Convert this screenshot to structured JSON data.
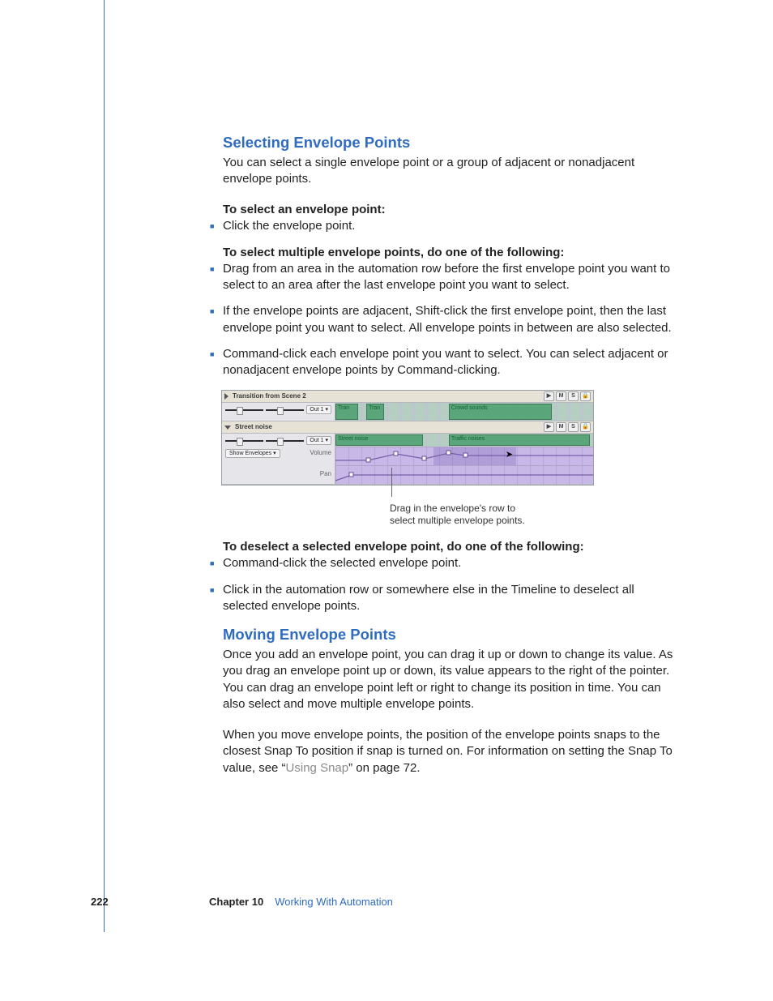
{
  "section1": {
    "title": "Selecting Envelope Points",
    "intro": "You can select a single envelope point or a group of adjacent or nonadjacent envelope points.",
    "lead1": "To select an envelope point:",
    "b1": "Click the envelope point.",
    "lead2": "To select multiple envelope points, do one of the following:",
    "b2a": "Drag from an area in the automation row before the first envelope point you want to select to an area after the last envelope point you want to select.",
    "b2b": "If the envelope points are adjacent, Shift-click the first envelope point, then the last envelope point you want to select. All envelope points in between are also selected.",
    "b2c": "Command-click each envelope point you want to select. You can select adjacent or nonadjacent envelope points by Command-clicking.",
    "lead3": "To deselect a selected envelope point, do one of the following:",
    "b3a": "Command-click the selected envelope point.",
    "b3b": "Click in the automation row or somewhere else in the Timeline to deselect all selected envelope points."
  },
  "figure": {
    "track1_name": "Transition from Scene 2",
    "track2_name": "Street noise",
    "out_label": "Out 1",
    "showenv_label": "Show Envelopes",
    "clip_tran": "Tran",
    "clip_crowd": "Crowd sounds",
    "clip_street": "Street noise",
    "clip_traffic": "Traffic noises",
    "env_vol": "Volume",
    "env_pan": "Pan",
    "btn_play": "▶",
    "btn_mute": "M",
    "btn_solo": "S",
    "btn_lock": "🔒",
    "caption_l1": "Drag in the envelope's row to",
    "caption_l2": "select multiple envelope points."
  },
  "section2": {
    "title": "Moving Envelope Points",
    "p1": "Once you add an envelope point, you can drag it up or down to change its value. As you drag an envelope point up or down, its value appears to the right of the pointer. You can drag an envelope point left or right to change its position in time. You can also select and move multiple envelope points.",
    "p2a": "When you move envelope points, the position of the envelope points snaps to the closest Snap To position if snap is turned on. For information on setting the Snap To value, see “",
    "p2_link": "Using Snap",
    "p2b": "” on page 72."
  },
  "footer": {
    "page": "222",
    "chapter_label": "Chapter 10",
    "chapter_title": "Working With Automation"
  }
}
